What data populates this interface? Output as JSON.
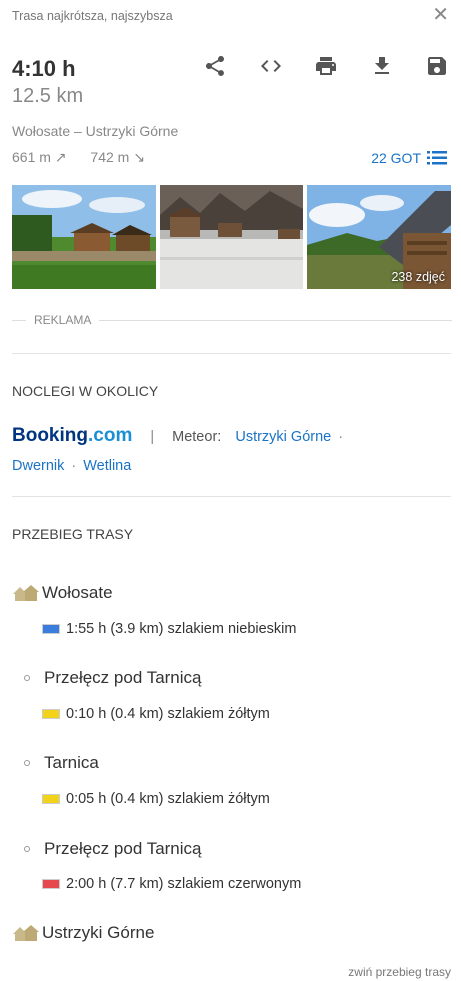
{
  "header": {
    "title": "Trasa najkrótsza, najszybsza",
    "close_icon": "close-icon"
  },
  "summary": {
    "time": "4:10 h",
    "distance": "12.5 km",
    "route_name": "Wołosate – Ustrzyki Górne",
    "ascent": "661 m ↗",
    "descent": "742 m ↘",
    "got_points": "22 GOT"
  },
  "toolbar": {
    "icons": [
      "share-icon",
      "embed-code-icon",
      "print-icon",
      "download-icon",
      "save-icon"
    ]
  },
  "photos": {
    "count_label": "238 zdjęć"
  },
  "ad": {
    "label": "REKLAMA"
  },
  "lodging": {
    "title": "NOCLEGI W OKOLICY",
    "booking_brand": "Booking",
    "booking_tld": ".com",
    "separator": "|",
    "meteor_label": "Meteor:",
    "links": [
      "Ustrzyki Górne",
      "Dwernik",
      "Wetlina"
    ],
    "dot": "·"
  },
  "route": {
    "title": "PRZEBIEG TRASY",
    "waypoints": [
      {
        "name": "Wołosate",
        "type": "shelter"
      },
      {
        "name": "Przełęcz pod Tarnicą",
        "type": "point"
      },
      {
        "name": "Tarnica",
        "type": "point"
      },
      {
        "name": "Przełęcz pod Tarnicą",
        "type": "point"
      },
      {
        "name": "Ustrzyki Górne",
        "type": "shelter"
      }
    ],
    "segments": [
      {
        "text": "1:55 h (3.9 km) szlakiem niebieskim",
        "color": "#3b7ddd"
      },
      {
        "text": "0:10 h (0.4 km) szlakiem żółtym",
        "color": "#f2d31b"
      },
      {
        "text": "0:05 h (0.4 km) szlakiem żółtym",
        "color": "#f2d31b"
      },
      {
        "text": "2:00 h (7.7 km) szlakiem czerwonym",
        "color": "#e5484d"
      }
    ],
    "collapse_label": "zwiń przebieg trasy"
  }
}
